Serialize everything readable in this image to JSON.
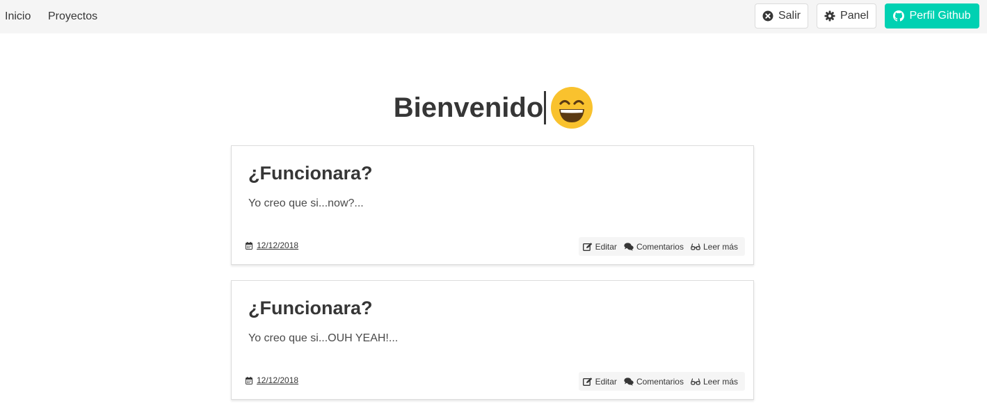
{
  "nav": {
    "links": [
      {
        "label": "Inicio"
      },
      {
        "label": "Proyectos"
      }
    ],
    "buttons": {
      "logout": {
        "label": "Salir",
        "icon": "times-circle-icon"
      },
      "panel": {
        "label": "Panel",
        "icon": "gear-icon"
      },
      "github": {
        "label": "Perfil Github",
        "icon": "github-icon"
      }
    }
  },
  "hero": {
    "title": "Bienvenido",
    "emoji": "grinning-face-icon"
  },
  "posts": [
    {
      "title": "¿Funcionara?",
      "excerpt": "Yo creo que si...now?...",
      "date": "12/12/2018",
      "actions": {
        "edit": "Editar",
        "comments": "Comentarios",
        "read_more": "Leer más"
      }
    },
    {
      "title": "¿Funcionara?",
      "excerpt": "Yo creo que si...OUH YEAH!...",
      "date": "12/12/2018",
      "actions": {
        "edit": "Editar",
        "comments": "Comentarios",
        "read_more": "Leer más"
      }
    }
  ],
  "colors": {
    "navbar_bg": "#f5f5f5",
    "primary": "#00d1b2",
    "text": "#363636",
    "emoji_face": "#f9c22e"
  }
}
